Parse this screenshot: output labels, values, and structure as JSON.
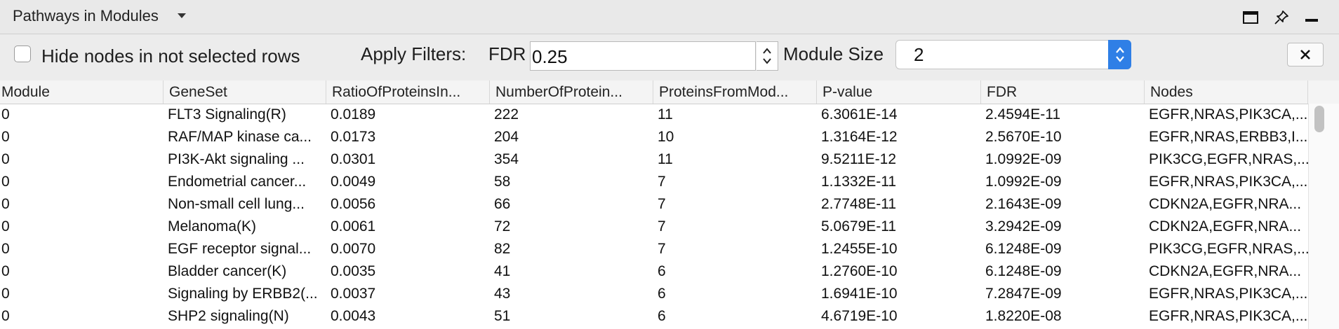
{
  "panel": {
    "title": "Pathways in Modules"
  },
  "filters": {
    "hide_nodes_label": "Hide nodes in not selected rows",
    "hide_nodes_checked": false,
    "apply_filters_label": "Apply Filters:",
    "fdr_label": "FDR",
    "fdr_value": "0.25",
    "module_size_label": "Module Size",
    "module_size_value": "2"
  },
  "icons": {
    "title_menu": "chevron-down-icon",
    "float": "window-icon",
    "pin": "pin-icon",
    "minimize": "minimize-icon",
    "close": "close-icon"
  },
  "table": {
    "columns": [
      "Module",
      "GeneSet",
      "RatioOfProteinsIn...",
      "NumberOfProtein...",
      "ProteinsFromMod...",
      "P-value",
      "FDR",
      "Nodes"
    ],
    "rows": [
      [
        "0",
        "FLT3 Signaling(R)",
        "0.0189",
        "222",
        "11",
        "6.3061E-14",
        "2.4594E-11",
        "EGFR,NRAS,PIK3CA,..."
      ],
      [
        "0",
        "RAF/MAP kinase ca...",
        "0.0173",
        "204",
        "10",
        "1.3164E-12",
        "2.5670E-10",
        "EGFR,NRAS,ERBB3,I..."
      ],
      [
        "0",
        "PI3K-Akt signaling ...",
        "0.0301",
        "354",
        "11",
        "9.5211E-12",
        "1.0992E-09",
        "PIK3CG,EGFR,NRAS,..."
      ],
      [
        "0",
        "Endometrial cancer...",
        "0.0049",
        "58",
        "7",
        "1.1332E-11",
        "1.0992E-09",
        "EGFR,NRAS,PIK3CA,..."
      ],
      [
        "0",
        "Non-small cell lung...",
        "0.0056",
        "66",
        "7",
        "2.7748E-11",
        "2.1643E-09",
        "CDKN2A,EGFR,NRA..."
      ],
      [
        "0",
        "Melanoma(K)",
        "0.0061",
        "72",
        "7",
        "5.0679E-11",
        "3.2942E-09",
        "CDKN2A,EGFR,NRA..."
      ],
      [
        "0",
        "EGF receptor signal...",
        "0.0070",
        "82",
        "7",
        "1.2455E-10",
        "6.1248E-09",
        "PIK3CG,EGFR,NRAS,..."
      ],
      [
        "0",
        "Bladder cancer(K)",
        "0.0035",
        "41",
        "6",
        "1.2760E-10",
        "6.1248E-09",
        "CDKN2A,EGFR,NRA..."
      ],
      [
        "0",
        "Signaling by ERBB2(...",
        "0.0037",
        "43",
        "6",
        "1.6941E-10",
        "7.2847E-09",
        "EGFR,NRAS,PIK3CA,..."
      ],
      [
        "0",
        "SHP2 signaling(N)",
        "0.0043",
        "51",
        "6",
        "4.6719E-10",
        "1.8220E-08",
        "EGFR,NRAS,PIK3CA,..."
      ]
    ]
  },
  "colors": {
    "accent": "#2f7fe6",
    "panel_bg": "#ececec",
    "table_bg": "#ffffff"
  }
}
